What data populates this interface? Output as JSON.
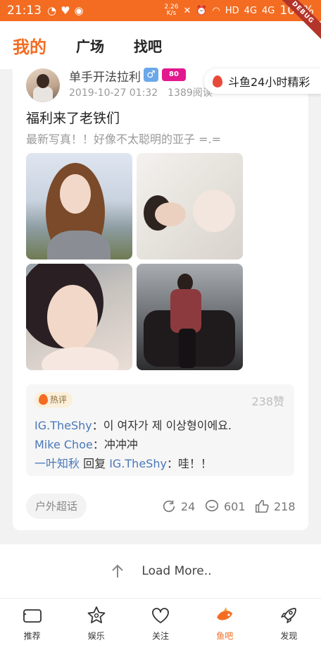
{
  "status_bar": {
    "time": "21:13",
    "net_speed_value": "2.26",
    "net_speed_unit": "K/s",
    "signal_hd": "HD",
    "signal_4g_a": "4G",
    "signal_4g_b": "4G",
    "battery": "100%"
  },
  "debug_label": "DEBUG",
  "top_tabs": [
    {
      "label": "我的",
      "active": true
    },
    {
      "label": "广场",
      "active": false
    },
    {
      "label": "找吧",
      "active": false
    }
  ],
  "post": {
    "username": "单手开法拉利",
    "gender_symbol": "♂",
    "level_badge": "80",
    "date": "2019-10-27 01:32",
    "views": "1389阅读",
    "title": "福利来了老铁们",
    "description": "最新写真！！好像不太聪明的亚子 =.=",
    "hot_label": "热评",
    "likes_count": "238赞",
    "comments": [
      {
        "user": "IG.TheShy",
        "reply_label": "",
        "reply_to": "",
        "text": "：이 여자가 제 이상형이에요."
      },
      {
        "user": "Mike Choe",
        "reply_label": "",
        "reply_to": "",
        "text": "：冲冲冲"
      },
      {
        "user": "一叶知秋",
        "reply_label": " 回复 ",
        "reply_to": "IG.TheShy",
        "text": "：哇！！"
      }
    ],
    "forum_tag": "户外超话",
    "shares": "24",
    "comment_count": "601",
    "like_count": "218"
  },
  "float_banner": {
    "text": "斗鱼24小时精彩"
  },
  "load_more": {
    "label": "Load More.."
  },
  "bottom_nav": [
    {
      "label": "推荐",
      "icon": "camera-icon",
      "active": false
    },
    {
      "label": "娱乐",
      "icon": "star-icon",
      "active": false
    },
    {
      "label": "关注",
      "icon": "heart-icon",
      "active": false
    },
    {
      "label": "鱼吧",
      "icon": "fish-icon",
      "active": true
    },
    {
      "label": "发现",
      "icon": "rocket-icon",
      "active": false
    }
  ],
  "colors": {
    "accent": "#f36c21",
    "link": "#4a78b8"
  }
}
